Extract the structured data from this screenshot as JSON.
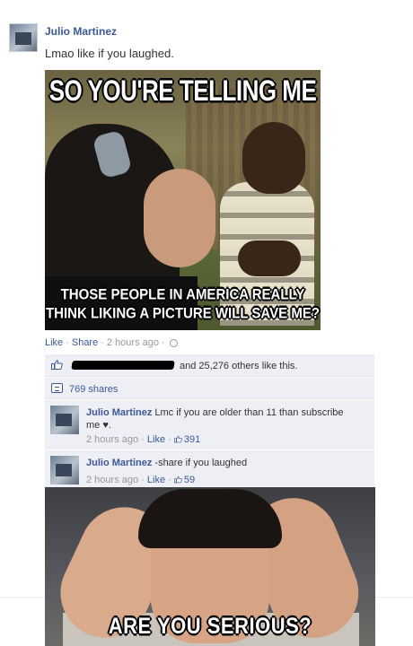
{
  "post": {
    "author": "Julio Martinez",
    "text": "Lmao like if you laughed.",
    "meme": {
      "caption_top": "SO YOU'RE TELLING ME",
      "caption_bottom": "THOSE PEOPLE IN AMERICA REALLY THINK LIKING A PICTURE WILL SAVE ME?"
    },
    "actions": {
      "like": "Like",
      "share": "Share",
      "time": "2 hours ago",
      "privacy_icon": "globe-icon"
    }
  },
  "ufi": {
    "likes_text": "and 25,276 others like this.",
    "shares_text": "769 shares",
    "icons": {
      "likes": "thumbs-up-icon",
      "shares": "share-icon"
    }
  },
  "comments": [
    {
      "author": "Julio Martinez",
      "text": "Lmc if you are older than 11 than subscribe me ♥.",
      "time": "2 hours ago",
      "like": "Like",
      "likes": "391"
    },
    {
      "author": "Julio Martinez",
      "text": "-share if you laughed",
      "time": "2 hours ago",
      "like": "Like",
      "likes": "59"
    }
  ],
  "meme2": {
    "caption_bottom": "ARE YOU SERIOUS?"
  },
  "colors": {
    "link": "#3b5998",
    "ufi_bg": "#edeff4",
    "muted": "#999999"
  }
}
